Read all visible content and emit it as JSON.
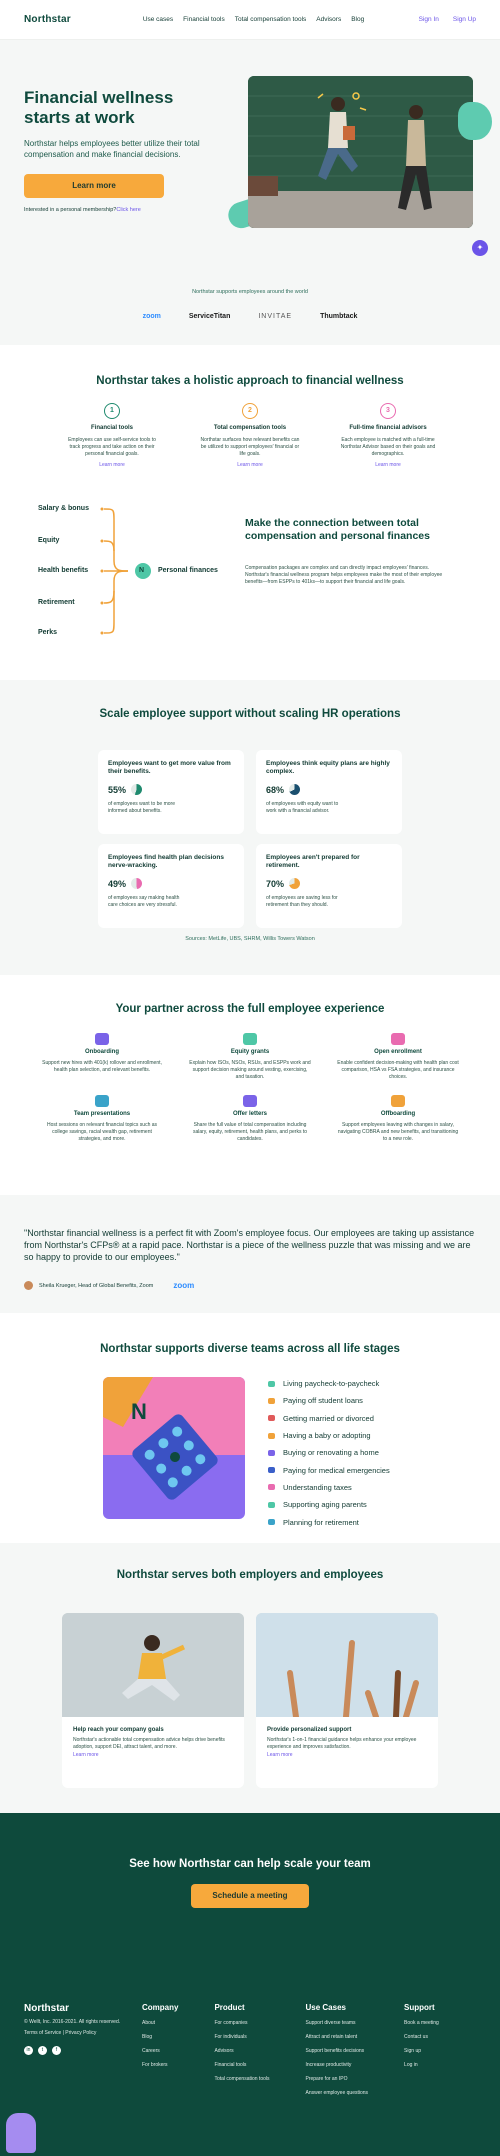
{
  "nav": {
    "logo": "Northstar",
    "links": [
      "Use cases",
      "Financial tools",
      "Total compensation tools",
      "Advisors",
      "Blog"
    ],
    "signin": "Sign In",
    "signup": "Sign Up"
  },
  "hero": {
    "title": "Financial wellness starts at work",
    "subtitle": "Northstar helps employees better utilize their total compensation and make financial decisions.",
    "cta": "Learn more",
    "membership_text": "Interested in a personal membership?",
    "membership_link": "Click here"
  },
  "trusted": {
    "text": "Northstar supports employees around the world",
    "brands": [
      "zoom",
      "ServiceTitan",
      "INVITAE",
      "Thumbtack"
    ]
  },
  "holistic": {
    "title": "Northstar takes a holistic approach to financial wellness",
    "pillars": [
      {
        "num": "1",
        "title": "Financial tools",
        "text": "Employees can use self-service tools to track progress and take action on their personal financial goals.",
        "link": "Learn more",
        "color": "#1f8a6e"
      },
      {
        "num": "2",
        "title": "Total compensation tools",
        "text": "Northstar surfaces how relevant benefits can be utilized to support employees' financial or life goals.",
        "link": "Learn more",
        "color": "#f0a23a"
      },
      {
        "num": "3",
        "title": "Full-time financial advisors",
        "text": "Each employee is matched with a full-time Northstar Advisor based on their goals and demographics.",
        "link": "Learn more",
        "color": "#e96bb0"
      }
    ],
    "flow_labels": [
      "Salary & bonus",
      "Equity",
      "Health benefits",
      "Retirement",
      "Perks"
    ],
    "hub": "Personal finances",
    "hub_icon": "N",
    "connection_title": "Make the connection between total compensation and personal finances",
    "connection_text": "Compensation packages are complex and can directly impact employees' finances. Northstar's financial wellness program helps employees make the most of their employee benefits—from ESPPs to 401ks—to support their financial and life goals."
  },
  "scale": {
    "title": "Scale employee support without scaling HR operations",
    "cards": [
      {
        "title": "Employees want to get more value from their benefits.",
        "pct": "55%",
        "text": "of employees want to be more informed about benefits.",
        "value": 55,
        "color": "#1f8a6e"
      },
      {
        "title": "Employees think equity plans are highly complex.",
        "pct": "68%",
        "text": "of employees with equity want to work with a financial advisor.",
        "value": 68,
        "color": "#1a4f6e"
      },
      {
        "title": "Employees find health plan decisions nerve-wracking.",
        "pct": "49%",
        "text": "of employees say making health care choices are very stressful.",
        "value": 49,
        "color": "#e96bb0"
      },
      {
        "title": "Employees aren't prepared for retirement.",
        "pct": "70%",
        "text": "of employees are saving less for retirement than they should.",
        "value": 70,
        "color": "#f0a23a"
      }
    ],
    "sources": "Sources: MetLife, UBS, SHRM, Willis Towers Watson"
  },
  "partner": {
    "title": "Your partner across the full employee experience",
    "items": [
      {
        "title": "Onboarding",
        "text": "Support new hires with 401(k) rollover and enrollment, health plan selection, and relevant benefits.",
        "color": "#7a63e8"
      },
      {
        "title": "Equity grants",
        "text": "Explain how ISOs, NSOs, RSUs, and ESPPs work and support decision making around vesting, exercising, and taxation.",
        "color": "#4ec7a6"
      },
      {
        "title": "Open enrollment",
        "text": "Enable confident decision-making with health plan cost comparison, HSA vs FSA strategies, and insurance choices.",
        "color": "#e96bb0"
      },
      {
        "title": "Team presentations",
        "text": "Host sessions on relevant financial topics such as college savings, racial wealth gap, retirement strategies, and more.",
        "color": "#3aa3c9"
      },
      {
        "title": "Offer letters",
        "text": "Share the full value of total compensation including salary, equity, retirement, health plans, and perks to candidates.",
        "color": "#7a63e8"
      },
      {
        "title": "Offboarding",
        "text": "Support employees leaving with changes in salary, navigating COBRA and new benefits, and transitioning to a new role.",
        "color": "#f0a23a"
      }
    ]
  },
  "testimonial": {
    "quote": "\"Northstar financial wellness is a perfect fit with Zoom's employee focus. Our employees are taking up assistance from Northstar's CFPs® at a rapid pace. Northstar is a piece of the wellness puzzle that was missing and we are so happy to provide to our employees.\"",
    "author": "Sheila Krueger, Head of Global Benefits, Zoom",
    "logo": "zoom"
  },
  "life": {
    "title": "Northstar supports diverse teams across all life stages",
    "items": [
      {
        "label": "Living paycheck-to-paycheck",
        "color": "#4ec7a6"
      },
      {
        "label": "Paying off student loans",
        "color": "#f0a23a"
      },
      {
        "label": "Getting married or divorced",
        "color": "#e05a5a"
      },
      {
        "label": "Having a baby or adopting",
        "color": "#f0a23a"
      },
      {
        "label": "Buying or renovating a home",
        "color": "#7a63e8"
      },
      {
        "label": "Paying for medical emergencies",
        "color": "#3a5fc9"
      },
      {
        "label": "Understanding taxes",
        "color": "#e96bb0"
      },
      {
        "label": "Supporting aging parents",
        "color": "#4ec7a6"
      },
      {
        "label": "Planning for retirement",
        "color": "#3aa3c9"
      }
    ]
  },
  "both": {
    "title": "Northstar serves both employers and employees",
    "cards": [
      {
        "title": "Help reach your company goals",
        "text": "Northstar's actionable total compensation advice helps drive benefits adoption, support DEI, attract talent, and more.",
        "link": "Learn more"
      },
      {
        "title": "Provide personalized support",
        "text": "Northstar's 1-on-1 financial guidance helps enhance your employee experience and improves satisfaction.",
        "link": "Learn more"
      }
    ]
  },
  "cta": {
    "title": "See how Northstar can help scale your team",
    "button": "Schedule a meeting"
  },
  "footer": {
    "logo": "Northstar",
    "copyright": "© Wellt, Inc. 2016-2021. All rights reserved.",
    "legal": "Terms of Service | Privacy Policy",
    "social": [
      "in",
      "t",
      "f"
    ],
    "columns": [
      {
        "title": "Company",
        "links": [
          "About",
          "Blog",
          "Careers",
          "For brokers"
        ]
      },
      {
        "title": "Product",
        "links": [
          "For companies",
          "For individuals",
          "Advisors",
          "Financial tools",
          "Total compensation tools"
        ]
      },
      {
        "title": "Use Cases",
        "links": [
          "Support diverse teams",
          "Attract and retain talent",
          "Support benefits decisions",
          "Increase productivity",
          "Prepare for an IPO",
          "Answer employee questions"
        ]
      },
      {
        "title": "Support",
        "links": [
          "Book a meeting",
          "Contact us",
          "Sign up",
          "Log in"
        ]
      }
    ]
  }
}
